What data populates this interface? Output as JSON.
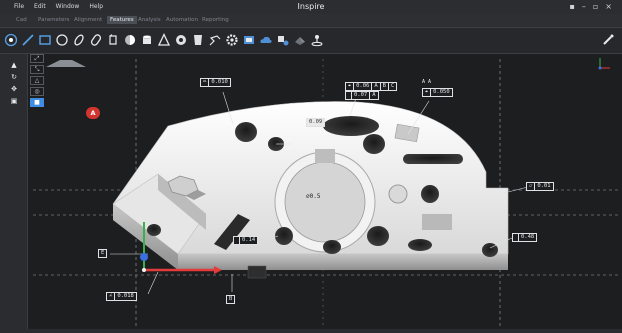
{
  "menu": [
    "File",
    "Edit",
    "Window",
    "Help"
  ],
  "app_title": "Inspire",
  "window_controls": [
    "save",
    "minimize",
    "restore",
    "close"
  ],
  "tabs": [
    {
      "label": "Cad",
      "active": false
    },
    {
      "label": "Parameters",
      "active": false
    },
    {
      "label": "Alignment",
      "active": false
    },
    {
      "label": "Features",
      "active": true
    },
    {
      "label": "Analysis",
      "active": false
    },
    {
      "label": "Automation",
      "active": false
    },
    {
      "label": "Reporting",
      "active": false
    }
  ],
  "toolbar_icons": [
    "point-icon",
    "line-icon",
    "rectangle-icon",
    "circle-icon",
    "ellipse-icon",
    "slot-icon",
    "polygon-icon",
    "sphere-icon",
    "cylinder-icon",
    "cone-icon",
    "torus-icon",
    "curve-icon",
    "spline-icon",
    "gear-icon",
    "surface-icon",
    "cloud-icon",
    "probe-icon",
    "scan-icon",
    "fixture-icon"
  ],
  "side_tools": [
    "select-icon",
    "rotate-icon",
    "pan-icon",
    "screenshot-icon"
  ],
  "view_tools": [
    "fit-icon",
    "fit-all-icon",
    "view-front-icon",
    "view-iso-icon",
    "camera-icon"
  ],
  "datum_badge": "A",
  "fcf": {
    "top_left": [
      "⌓",
      "0.010"
    ],
    "top_center": [
      "⌖",
      "0.06",
      "A",
      "B",
      "C"
    ],
    "top_center_row2": [
      "",
      "0.07",
      "A"
    ],
    "top_right": [
      "⌖",
      "0.050"
    ],
    "right_upper": [
      "▱",
      "0.01"
    ],
    "right_lower": [
      "",
      "0.48"
    ],
    "left_mid": [
      "E"
    ],
    "bottom_left": [
      "∠",
      "0.018"
    ],
    "bottom_center": [
      "B"
    ],
    "lower_mid": [
      "",
      "0.14"
    ],
    "hole_label": [
      "0.09"
    ]
  },
  "dims": {
    "center_bore": "⌀0.5",
    "corner_mark": "A  A"
  },
  "colors": {
    "accent_blue": "#3e8de3",
    "badge_red": "#d2342f",
    "axis_x": "#e23b3b",
    "axis_y": "#36b24a",
    "axis_z": "#3a6fe0"
  }
}
